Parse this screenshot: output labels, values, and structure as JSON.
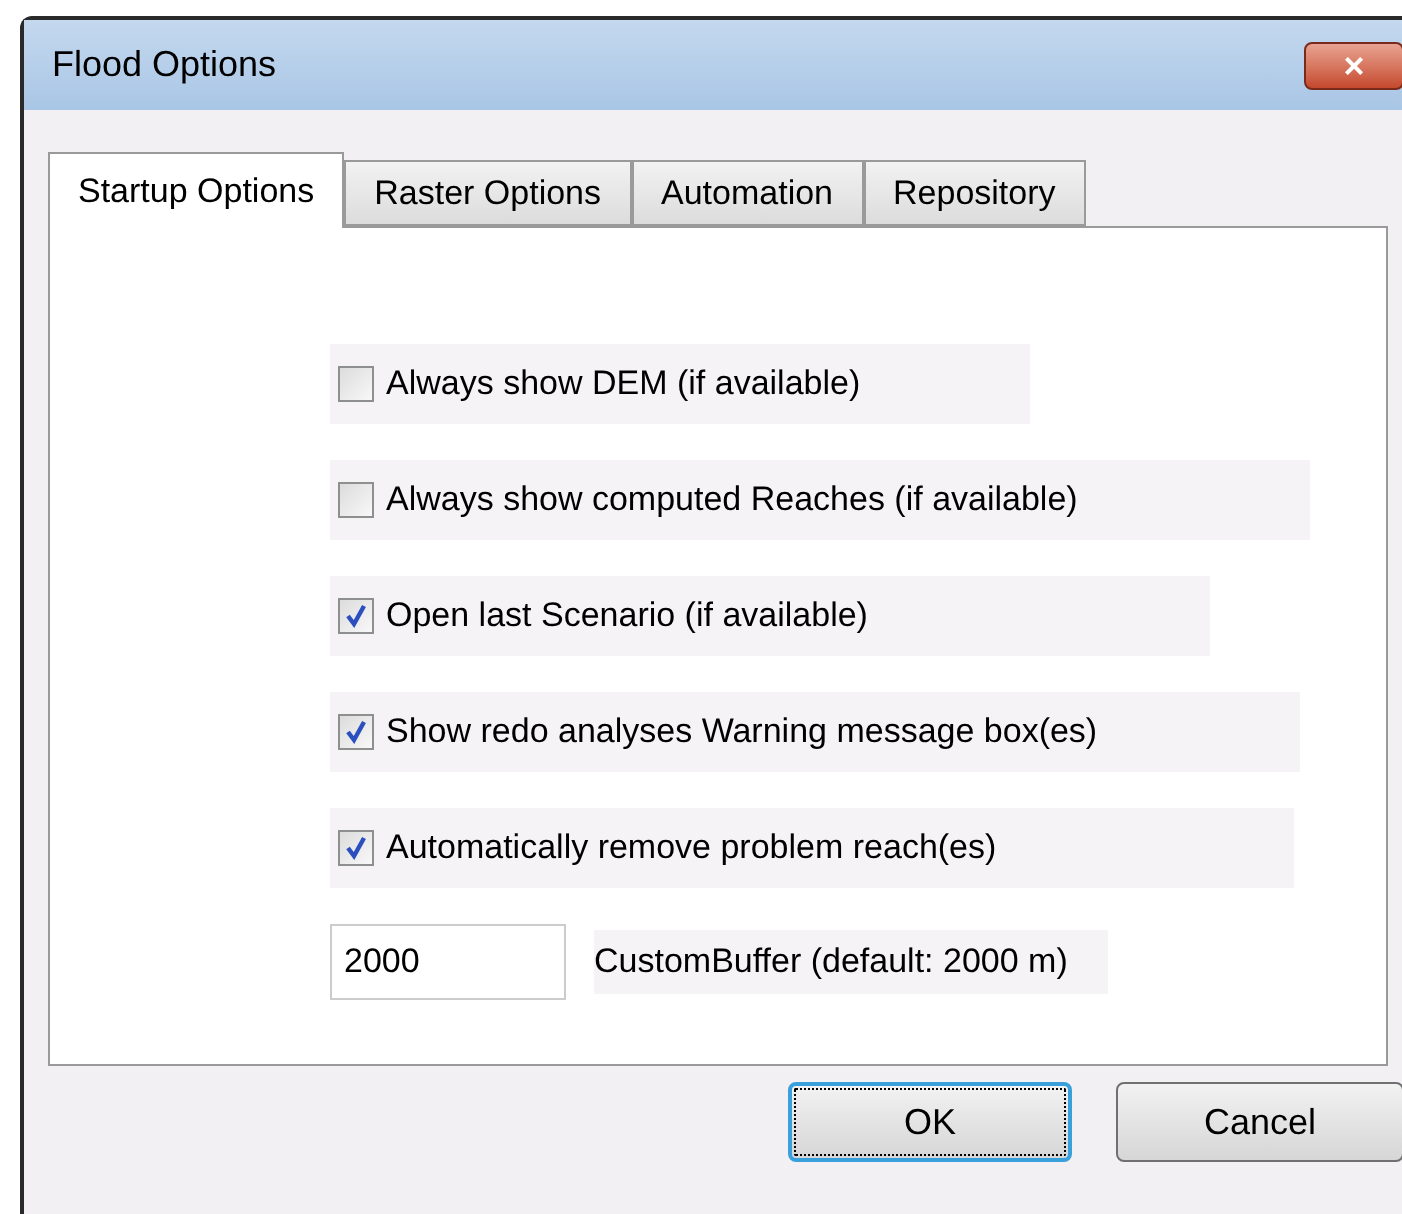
{
  "window": {
    "title": "Flood Options",
    "close": "×"
  },
  "tabs": [
    {
      "label": "Startup Options",
      "selected": true
    },
    {
      "label": "Raster Options",
      "selected": false
    },
    {
      "label": "Automation",
      "selected": false
    },
    {
      "label": "Repository",
      "selected": false
    }
  ],
  "options": [
    {
      "label": "Always show DEM (if available)",
      "checked": false
    },
    {
      "label": "Always show computed Reaches (if available)",
      "checked": false
    },
    {
      "label": "Open last Scenario (if available)",
      "checked": true
    },
    {
      "label": "Show redo analyses Warning message box(es)",
      "checked": true
    },
    {
      "label": "Automatically remove problem reach(es)",
      "checked": true
    }
  ],
  "buffer": {
    "value": "2000",
    "label": "CustomBuffer (default: 2000 m)"
  },
  "buttons": [
    {
      "label": "OK",
      "focused": true
    },
    {
      "label": "Cancel",
      "focused": false
    }
  ]
}
